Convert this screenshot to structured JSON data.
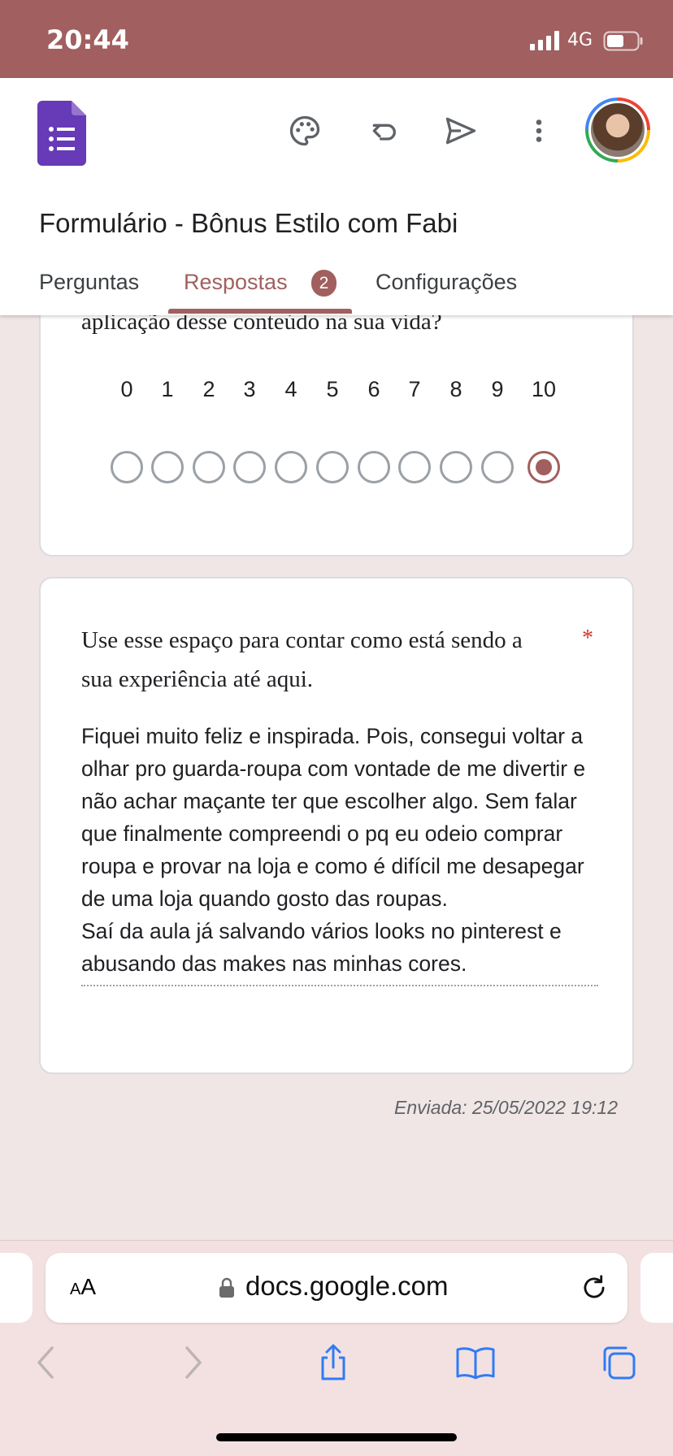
{
  "status_bar": {
    "time": "20:44",
    "network": "4G"
  },
  "header": {
    "form_title": "Formulário - Bônus Estilo com Fabi",
    "tabs": [
      {
        "label": "Perguntas"
      },
      {
        "label": "Respostas",
        "badge": "2"
      },
      {
        "label": "Configurações"
      }
    ],
    "icons": [
      "palette-icon",
      "undo-icon",
      "send-icon",
      "more-vert-icon"
    ]
  },
  "scale_question": {
    "partial_text": "aplicação desse conteúdo na sua vida?",
    "scale_labels": [
      "0",
      "1",
      "2",
      "3",
      "4",
      "5",
      "6",
      "7",
      "8",
      "9",
      "10"
    ],
    "selected_value": 10
  },
  "text_question": {
    "question": "Use esse espaço para contar como está sendo a sua experiência até aqui.",
    "required_marker": "*",
    "answer": "Fiquei muito feliz e inspirada. Pois, consegui voltar a olhar pro guarda-roupa com vontade de me divertir e não achar maçante ter que escolher algo. Sem falar que finalmente compreendi o pq eu odeio comprar roupa e provar na loja e como é difícil me desapegar de uma loja quando gosto das roupas.\nSaí da aula já salvando vários looks no pinterest e abusando das makes nas minhas cores."
  },
  "submitted_label": "Enviada: 25/05/2022 19:12",
  "browser": {
    "aa_large": "A",
    "aa_small": "A",
    "url": "docs.google.com"
  },
  "colors": {
    "accent": "#a25f5f",
    "forms_purple": "#673ab7",
    "required": "#d93025"
  }
}
